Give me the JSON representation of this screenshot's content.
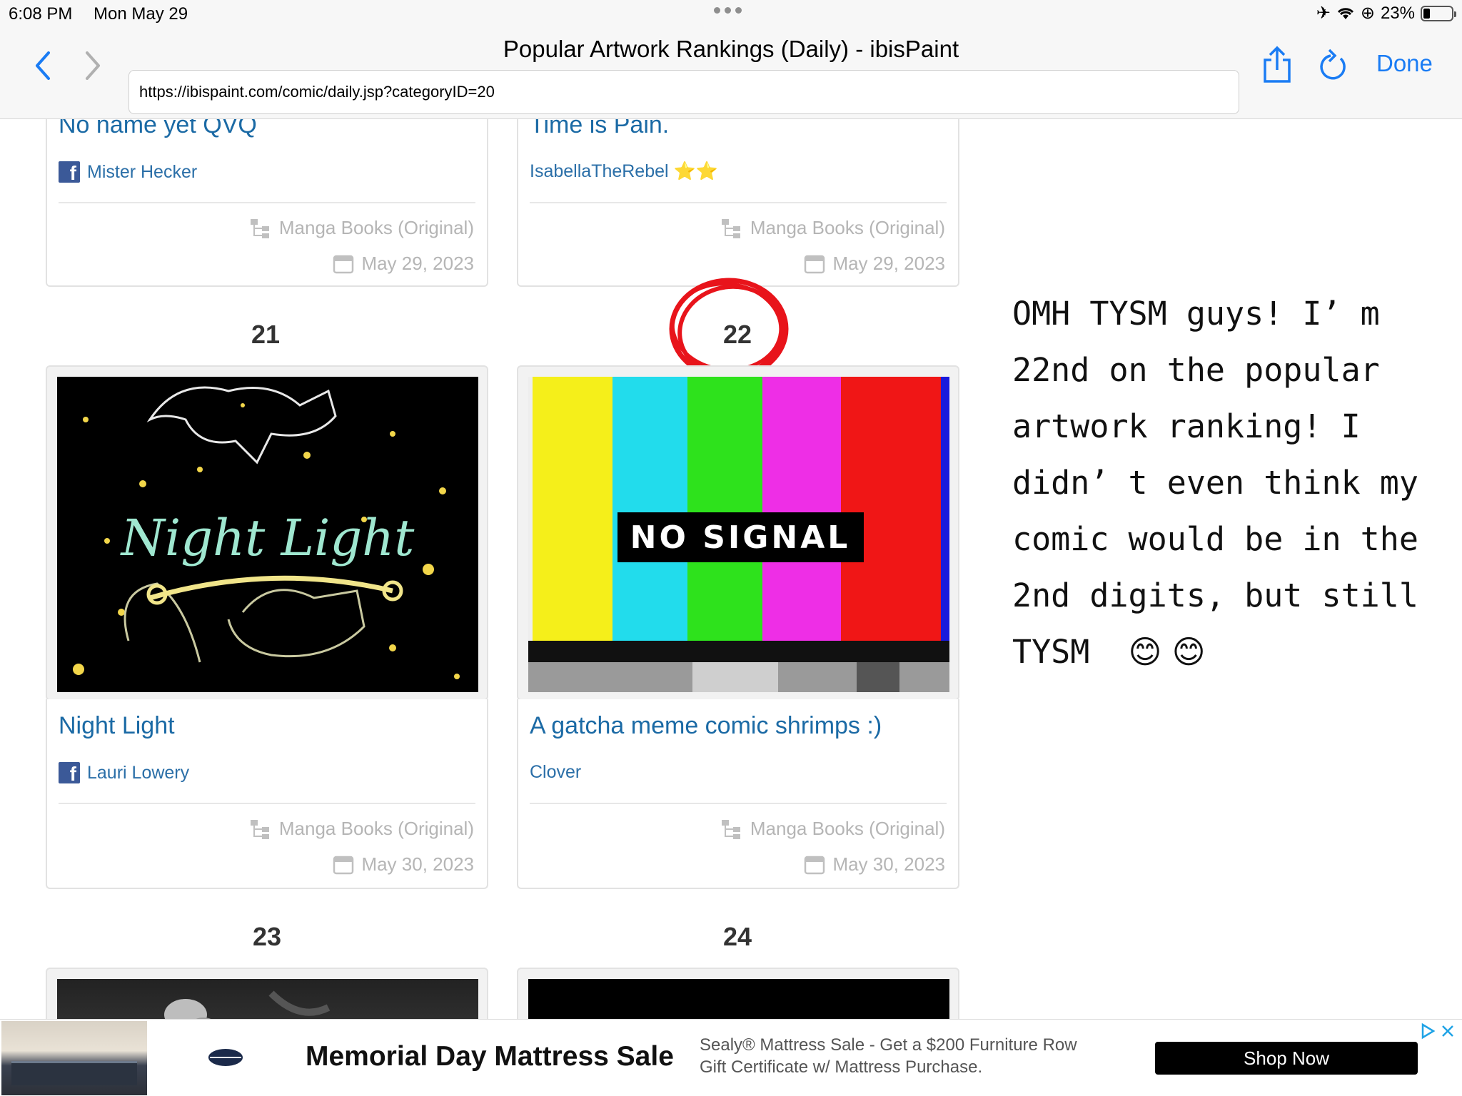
{
  "status_bar": {
    "time": "6:08 PM",
    "date": "Mon May 29",
    "battery": "23%",
    "battery_level": 0.23
  },
  "browser": {
    "title": "Popular Artwork Rankings (Daily) - ibisPaint",
    "url": "https://ibispaint.com/comic/daily.jsp?categoryID=20",
    "done_label": "Done"
  },
  "cards_top": [
    {
      "title": "No name yet QVQ",
      "author": "Mister Hecker",
      "facebook": true,
      "category": "Manga Books (Original)",
      "date": "May 29, 2023"
    },
    {
      "title": "Time is Pain.",
      "author": "IsabellaTheRebel ⭐⭐",
      "facebook": false,
      "category": "Manga Books (Original)",
      "date": "May 29, 2023"
    }
  ],
  "ranked": [
    {
      "rank": "21",
      "title": "Night Light",
      "author": "Lauri Lowery",
      "facebook": true,
      "category": "Manga Books (Original)",
      "date": "May 30, 2023",
      "thumb_text": "Night Light"
    },
    {
      "rank": "22",
      "title": "A gatcha meme comic shrimps :)",
      "author": "Clover",
      "facebook": false,
      "category": "Manga Books (Original)",
      "date": "May 30, 2023",
      "thumb_text": "NO SIGNAL"
    }
  ],
  "next_ranks": [
    "23",
    "24"
  ],
  "note": {
    "lines": [
      "OMH TYSM guys! I’ m",
      "22nd on the popular",
      "artwork ranking! I",
      "didn’ t even think my",
      "comic would be in the",
      "2nd digits, but still",
      "TYSM"
    ],
    "emoji": "😊 😊"
  },
  "ad": {
    "headline": "Memorial Day Mattress Sale",
    "body": "Sealy® Mattress Sale - Get a $200 Furniture Row Gift Certificate w/ Mattress Purchase.",
    "cta": "Shop Now"
  },
  "colors": {
    "link": "#1b6aa5",
    "accent": "#1a7cf4",
    "circle": "#e8141b"
  }
}
